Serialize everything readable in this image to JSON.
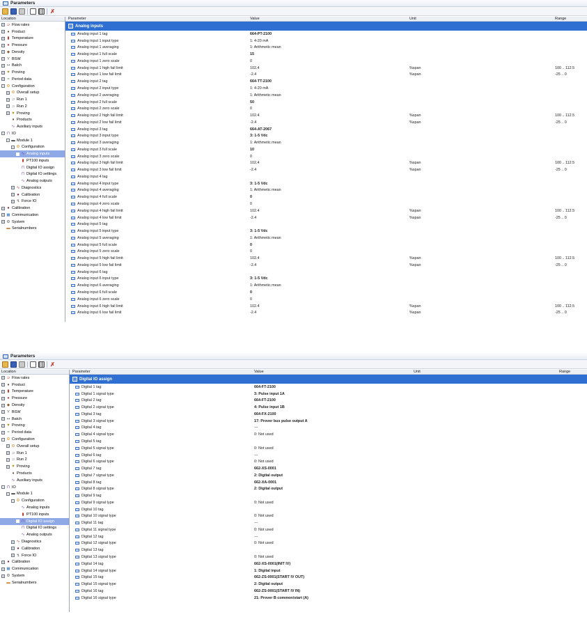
{
  "window_title": "Parameters",
  "columns": {
    "location": "Location",
    "parameter": "Parameter",
    "value": "Value",
    "unit": "Unit",
    "range": "Range"
  },
  "toolbar": [
    "open-icon",
    "save-icon",
    "print-icon",
    "tree-icon",
    "grid-icon",
    "reset-icon"
  ],
  "panel1": {
    "group": "Analog inputs",
    "tree": [
      {
        "label": "Flow rates",
        "level": 0,
        "exp": "+"
      },
      {
        "label": "Product",
        "level": 0,
        "exp": "+"
      },
      {
        "label": "Temperature",
        "level": 0,
        "exp": "+"
      },
      {
        "label": "Pressure",
        "level": 0,
        "exp": "+"
      },
      {
        "label": "Density",
        "level": 0,
        "exp": "+"
      },
      {
        "label": "BSW",
        "level": 0,
        "exp": "+"
      },
      {
        "label": "Batch",
        "level": 0,
        "exp": "+"
      },
      {
        "label": "Proving",
        "level": 0,
        "exp": "+"
      },
      {
        "label": "Period data",
        "level": 0,
        "exp": "+"
      },
      {
        "label": "Configuration",
        "level": 0,
        "exp": "-"
      },
      {
        "label": "Overall setup",
        "level": 1,
        "exp": "+"
      },
      {
        "label": "Run 1",
        "level": 1,
        "exp": "+"
      },
      {
        "label": "Run 2",
        "level": 1,
        "exp": "+"
      },
      {
        "label": "Proving",
        "level": 1,
        "exp": "+"
      },
      {
        "label": "Products",
        "level": 1,
        "exp": ""
      },
      {
        "label": "Auxiliary inputs",
        "level": 1,
        "exp": ""
      },
      {
        "label": "IO",
        "level": 0,
        "exp": "-"
      },
      {
        "label": "Module 1",
        "level": 1,
        "exp": "-"
      },
      {
        "label": "Configuration",
        "level": 2,
        "exp": "-"
      },
      {
        "label": "Analog inputs",
        "level": 3,
        "exp": "",
        "selected": true
      },
      {
        "label": "PT100 inputs",
        "level": 3,
        "exp": ""
      },
      {
        "label": "Digital IO assign",
        "level": 3,
        "exp": ""
      },
      {
        "label": "Digital IO settings",
        "level": 3,
        "exp": ""
      },
      {
        "label": "Analog outputs",
        "level": 3,
        "exp": ""
      },
      {
        "label": "Diagnostics",
        "level": 2,
        "exp": "+"
      },
      {
        "label": "Calibration",
        "level": 2,
        "exp": "+"
      },
      {
        "label": "Force IO",
        "level": 2,
        "exp": "+"
      },
      {
        "label": "Calibration",
        "level": 0,
        "exp": "+"
      },
      {
        "label": "Communication",
        "level": 0,
        "exp": "+"
      },
      {
        "label": "System",
        "level": 0,
        "exp": "+"
      },
      {
        "label": "Serialnumbers",
        "level": 0,
        "exp": ""
      }
    ],
    "rows": [
      {
        "p": "Analog input 1 tag",
        "v": "664-PT-2100",
        "u": "",
        "r": "",
        "b": true
      },
      {
        "p": "Analog input 1 input type",
        "v": "1: 4-20 mA",
        "u": "",
        "r": ""
      },
      {
        "p": "Analog input 1 averaging",
        "v": "1: Arithmetic mean",
        "u": "",
        "r": ""
      },
      {
        "p": "Analog input 1 full scale",
        "v": "15",
        "u": "",
        "r": "",
        "b": true
      },
      {
        "p": "Analog input 1 zero scale",
        "v": "0",
        "u": "",
        "r": ""
      },
      {
        "p": "Analog input 1 high fail limit",
        "v": "102.4",
        "u": "%span",
        "r": "100 .. 112.5"
      },
      {
        "p": "Analog input 1 low fail limit",
        "v": "-2.4",
        "u": "%span",
        "r": "-25 .. 0"
      },
      {
        "p": "Analog input 2 tag",
        "v": "664-TT-2100",
        "u": "",
        "r": "",
        "b": true
      },
      {
        "p": "Analog input 2 input type",
        "v": "1: 4-20 mA",
        "u": "",
        "r": ""
      },
      {
        "p": "Analog input 2 averaging",
        "v": "1: Arithmetic mean",
        "u": "",
        "r": ""
      },
      {
        "p": "Analog input 2 full scale",
        "v": "50",
        "u": "",
        "r": "",
        "b": true
      },
      {
        "p": "Analog input 2 zero scale",
        "v": "0",
        "u": "",
        "r": ""
      },
      {
        "p": "Analog input 2 high fail limit",
        "v": "102.4",
        "u": "%span",
        "r": "100 .. 112.5"
      },
      {
        "p": "Analog input 2 low fail limit",
        "v": "-2.4",
        "u": "%span",
        "r": "-25 .. 0"
      },
      {
        "p": "Analog input 3 tag",
        "v": "664-AT-2067",
        "u": "",
        "r": "",
        "b": true
      },
      {
        "p": "Analog input 3 input type",
        "v": "3: 1-5 Vdc",
        "u": "",
        "r": "",
        "b": true
      },
      {
        "p": "Analog input 3 averaging",
        "v": "1: Arithmetic mean",
        "u": "",
        "r": ""
      },
      {
        "p": "Analog input 3 full scale",
        "v": "10",
        "u": "",
        "r": "",
        "b": true
      },
      {
        "p": "Analog input 3 zero scale",
        "v": "0",
        "u": "",
        "r": ""
      },
      {
        "p": "Analog input 3 high fail limit",
        "v": "102.4",
        "u": "%span",
        "r": "100 .. 112.5"
      },
      {
        "p": "Analog input 3 low fail limit",
        "v": "-2.4",
        "u": "%span",
        "r": "-25 .. 0"
      },
      {
        "p": "Analog input 4 tag",
        "v": "",
        "u": "",
        "r": ""
      },
      {
        "p": "Analog input 4 input type",
        "v": "3: 1-5 Vdc",
        "u": "",
        "r": "",
        "b": true
      },
      {
        "p": "Analog input 4 averaging",
        "v": "1: Arithmetic mean",
        "u": "",
        "r": ""
      },
      {
        "p": "Analog input 4 full scale",
        "v": "0",
        "u": "",
        "r": "",
        "b": true
      },
      {
        "p": "Analog input 4 zero scale",
        "v": "0",
        "u": "",
        "r": ""
      },
      {
        "p": "Analog input 4 high fail limit",
        "v": "102.4",
        "u": "%span",
        "r": "100 .. 112.5"
      },
      {
        "p": "Analog input 4 low fail limit",
        "v": "-2.4",
        "u": "%span",
        "r": "-25 .. 0"
      },
      {
        "p": "Analog input 5 tag",
        "v": "",
        "u": "",
        "r": ""
      },
      {
        "p": "Analog input 5 input type",
        "v": "3: 1-5 Vdc",
        "u": "",
        "r": "",
        "b": true
      },
      {
        "p": "Analog input 5 averaging",
        "v": "1: Arithmetic mean",
        "u": "",
        "r": ""
      },
      {
        "p": "Analog input 5 full scale",
        "v": "0",
        "u": "",
        "r": "",
        "b": true
      },
      {
        "p": "Analog input 5 zero scale",
        "v": "0",
        "u": "",
        "r": ""
      },
      {
        "p": "Analog input 5 high fail limit",
        "v": "102.4",
        "u": "%span",
        "r": "100 .. 112.5"
      },
      {
        "p": "Analog input 5 low fail limit",
        "v": "-2.4",
        "u": "%span",
        "r": "-25 .. 0"
      },
      {
        "p": "Analog input 6 tag",
        "v": "",
        "u": "",
        "r": ""
      },
      {
        "p": "Analog input 6 input type",
        "v": "3: 1-5 Vdc",
        "u": "",
        "r": "",
        "b": true
      },
      {
        "p": "Analog input 6 averaging",
        "v": "1: Arithmetic mean",
        "u": "",
        "r": ""
      },
      {
        "p": "Analog input 6 full scale",
        "v": "0",
        "u": "",
        "r": "",
        "b": true
      },
      {
        "p": "Analog input 6 zero scale",
        "v": "0",
        "u": "",
        "r": ""
      },
      {
        "p": "Analog input 6 high fail limit",
        "v": "102.4",
        "u": "%span",
        "r": "100 .. 112.5"
      },
      {
        "p": "Analog input 6 low fail limit",
        "v": "-2.4",
        "u": "%span",
        "r": "-25 .. 0"
      }
    ]
  },
  "panel2": {
    "group": "Digital IO assign",
    "tree": [
      {
        "label": "Flow rates",
        "level": 0,
        "exp": "+"
      },
      {
        "label": "Product",
        "level": 0,
        "exp": "+"
      },
      {
        "label": "Temperature",
        "level": 0,
        "exp": "+"
      },
      {
        "label": "Pressure",
        "level": 0,
        "exp": "+"
      },
      {
        "label": "Density",
        "level": 0,
        "exp": "+"
      },
      {
        "label": "BSW",
        "level": 0,
        "exp": "+"
      },
      {
        "label": "Batch",
        "level": 0,
        "exp": "+"
      },
      {
        "label": "Proving",
        "level": 0,
        "exp": "+"
      },
      {
        "label": "Period data",
        "level": 0,
        "exp": "+"
      },
      {
        "label": "Configuration",
        "level": 0,
        "exp": "-"
      },
      {
        "label": "Overall setup",
        "level": 1,
        "exp": "+"
      },
      {
        "label": "Run 1",
        "level": 1,
        "exp": "+"
      },
      {
        "label": "Run 2",
        "level": 1,
        "exp": "+"
      },
      {
        "label": "Proving",
        "level": 1,
        "exp": "+"
      },
      {
        "label": "Products",
        "level": 1,
        "exp": ""
      },
      {
        "label": "Auxiliary inputs",
        "level": 1,
        "exp": ""
      },
      {
        "label": "IO",
        "level": 0,
        "exp": "-"
      },
      {
        "label": "Module 1",
        "level": 1,
        "exp": "-"
      },
      {
        "label": "Configuration",
        "level": 2,
        "exp": "-"
      },
      {
        "label": "Analog inputs",
        "level": 3,
        "exp": ""
      },
      {
        "label": "PT100 inputs",
        "level": 3,
        "exp": ""
      },
      {
        "label": "Digital IO assign",
        "level": 3,
        "exp": "",
        "selected": true
      },
      {
        "label": "Digital IO settings",
        "level": 3,
        "exp": ""
      },
      {
        "label": "Analog outputs",
        "level": 3,
        "exp": ""
      },
      {
        "label": "Diagnostics",
        "level": 2,
        "exp": "+"
      },
      {
        "label": "Calibration",
        "level": 2,
        "exp": "+"
      },
      {
        "label": "Force IO",
        "level": 2,
        "exp": "+"
      },
      {
        "label": "Calibration",
        "level": 0,
        "exp": "+"
      },
      {
        "label": "Communication",
        "level": 0,
        "exp": "+"
      },
      {
        "label": "System",
        "level": 0,
        "exp": "+"
      },
      {
        "label": "Serialnumbers",
        "level": 0,
        "exp": ""
      }
    ],
    "rows": [
      {
        "p": "Digital 1 tag",
        "v": "664-FT-2100",
        "b": true
      },
      {
        "p": "Digital 1 signal type",
        "v": "3: Pulse input 1A",
        "b": true
      },
      {
        "p": "Digital 2 tag",
        "v": "664-FT-2100",
        "b": true
      },
      {
        "p": "Digital 2 signal type",
        "v": "4: Pulse input 1B",
        "b": true
      },
      {
        "p": "Digital 3 tag",
        "v": "664-FX-2100",
        "b": true
      },
      {
        "p": "Digital 3 signal type",
        "v": "17: Prover bus pulse output A",
        "b": true
      },
      {
        "p": "Digital 4 tag",
        "v": "---"
      },
      {
        "p": "Digital 4 signal type",
        "v": "0: Not used"
      },
      {
        "p": "Digital 5 tag",
        "v": ""
      },
      {
        "p": "Digital 5 signal type",
        "v": "0: Not used"
      },
      {
        "p": "Digital 6 tag",
        "v": "---"
      },
      {
        "p": "Digital 6 signal type",
        "v": "0: Not used"
      },
      {
        "p": "Digital 7 tag",
        "v": "662-XS-0001",
        "b": true
      },
      {
        "p": "Digital 7 signal type",
        "v": "2: Digital output",
        "b": true
      },
      {
        "p": "Digital 8 tag",
        "v": "662-XA-0001",
        "b": true
      },
      {
        "p": "Digital 8 signal type",
        "v": "2: Digital output",
        "b": true
      },
      {
        "p": "Digital 9 tag",
        "v": ""
      },
      {
        "p": "Digital 9 signal type",
        "v": "0: Not used"
      },
      {
        "p": "Digital 10 tag",
        "v": ""
      },
      {
        "p": "Digital 10 signal type",
        "v": "0: Not used"
      },
      {
        "p": "Digital 11 tag",
        "v": "---"
      },
      {
        "p": "Digital 11 signal type",
        "v": "0: Not used"
      },
      {
        "p": "Digital 12 tag",
        "v": "---"
      },
      {
        "p": "Digital 12 signal type",
        "v": "0: Not used"
      },
      {
        "p": "Digital 13 tag",
        "v": ""
      },
      {
        "p": "Digital 13 signal type",
        "v": "0: Not used"
      },
      {
        "p": "Digital 14 tag",
        "v": "662-XS-0001(INIT IV)",
        "b": true
      },
      {
        "p": "Digital 14 signal type",
        "v": "1: Digital input",
        "b": true
      },
      {
        "p": "Digital 15 tag",
        "v": "662-ZS-0001(START IV OUT)",
        "b": true
      },
      {
        "p": "Digital 15 signal type",
        "v": "2: Digital output",
        "b": true
      },
      {
        "p": "Digital 16 tag",
        "v": "662-ZS-0001(START IV IN)",
        "b": true
      },
      {
        "p": "Digital 16 signal type",
        "v": "21: Prover B common/start (A)",
        "b": true
      }
    ]
  },
  "colors": {
    "band": "#2f6fd1",
    "selected": "#8ea9e6"
  }
}
